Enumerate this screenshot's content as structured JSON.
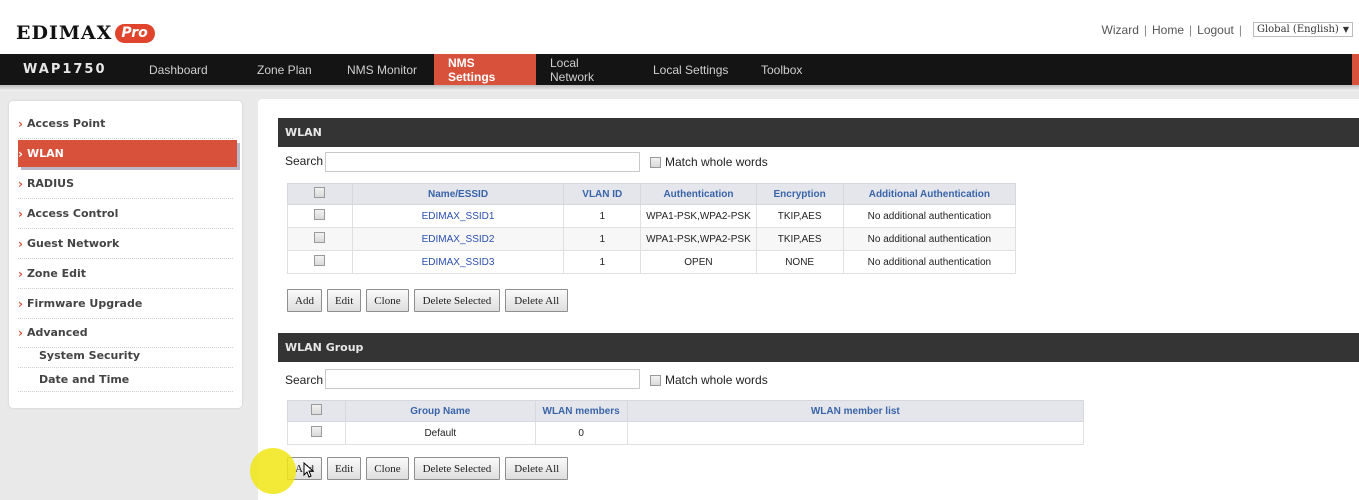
{
  "header": {
    "logo_text": "EDIMAX",
    "logo_badge": "Pro",
    "links": [
      "Wizard",
      "Home",
      "Logout"
    ],
    "language": "Global (English)"
  },
  "nav": {
    "model": "WAP1750",
    "tabs": [
      "Dashboard",
      "Zone Plan",
      "NMS Monitor",
      "NMS Settings",
      "Local Network",
      "Local Settings",
      "Toolbox"
    ],
    "active_tab": "NMS Settings"
  },
  "sidebar": {
    "items": [
      {
        "label": "Access Point"
      },
      {
        "label": "WLAN"
      },
      {
        "label": "RADIUS"
      },
      {
        "label": "Access Control"
      },
      {
        "label": "Guest Network"
      },
      {
        "label": "Zone Edit"
      },
      {
        "label": "Firmware Upgrade"
      },
      {
        "label": "Advanced"
      }
    ],
    "subitems": [
      {
        "label": "System Security"
      },
      {
        "label": "Date and Time"
      }
    ],
    "active": "WLAN"
  },
  "wlan": {
    "title": "WLAN",
    "search_label": "Search",
    "search_value": "",
    "match_label": "Match whole words",
    "columns": [
      "Name/ESSID",
      "VLAN ID",
      "Authentication",
      "Encryption",
      "Additional Authentication"
    ],
    "rows": [
      {
        "name": "EDIMAX_SSID1",
        "vlan": "1",
        "auth": "WPA1-PSK,WPA2-PSK",
        "enc": "TKIP,AES",
        "addl": "No additional authentication"
      },
      {
        "name": "EDIMAX_SSID2",
        "vlan": "1",
        "auth": "WPA1-PSK,WPA2-PSK",
        "enc": "TKIP,AES",
        "addl": "No additional authentication"
      },
      {
        "name": "EDIMAX_SSID3",
        "vlan": "1",
        "auth": "OPEN",
        "enc": "NONE",
        "addl": "No additional authentication"
      }
    ],
    "buttons": [
      "Add",
      "Edit",
      "Clone",
      "Delete Selected",
      "Delete All"
    ]
  },
  "wlan_group": {
    "title": "WLAN Group",
    "search_label": "Search",
    "search_value": "",
    "match_label": "Match whole words",
    "columns": [
      "Group Name",
      "WLAN members",
      "WLAN member list"
    ],
    "rows": [
      {
        "name": "Default",
        "members": "0",
        "list": ""
      }
    ],
    "buttons": [
      "Add",
      "Edit",
      "Clone",
      "Delete Selected",
      "Delete All"
    ]
  },
  "colors": {
    "accent": "#d8513b",
    "nav_bg": "#141414",
    "section_header_bg": "#343434",
    "link_blue": "#2a4fb0",
    "highlight": "#f0e614"
  }
}
